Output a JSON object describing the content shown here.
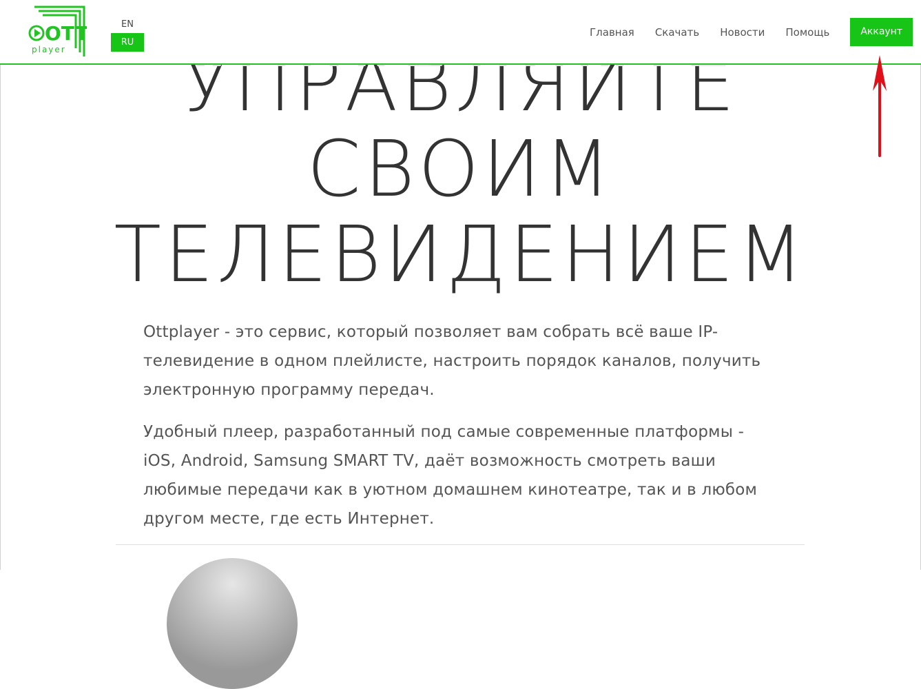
{
  "logo": {
    "text": "OTT",
    "subtext": "player"
  },
  "languages": {
    "en": "EN",
    "ru": "RU",
    "active": "RU"
  },
  "nav": {
    "home": "Главная",
    "download": "Скачать",
    "news": "Новости",
    "help": "Помощь",
    "account": "Аккаунт"
  },
  "hero": {
    "ghost": "УПРАВЛЯЙТЕ",
    "line1": "УПРАВЛЯЙТЕ",
    "line2": "СВОИМ",
    "line3": "ТЕЛЕВИДЕНИЕМ"
  },
  "content": {
    "paragraph1": "Ottplayer - это сервис, который позволяет вам собрать всё ваше IP-телевидение в одном плейлисте, настроить порядок каналов, получить электронную программу передач.",
    "paragraph2": "Удобный плеер, разработанный под самые современные платформы - iOS, Android, Samsung SMART TV, даёт возможность смотреть ваши любимые передачи как в уютном домашнем кинотеатре, так и в любом другом месте, где есть Интернет."
  },
  "colors": {
    "accent": "#16c516",
    "annotation": "#e0101a"
  }
}
